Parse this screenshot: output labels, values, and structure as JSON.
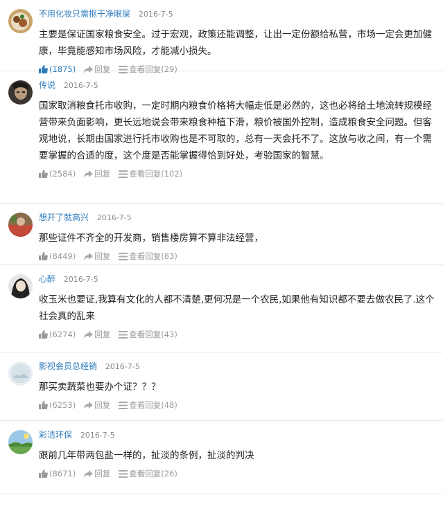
{
  "labels": {
    "reply": "回复",
    "view_replies": "查看回复"
  },
  "comments": [
    {
      "username": "不用化妆只需抠干净眼屎",
      "date": "2016-7-5",
      "text": "主要是保证国家粮食安全。过于宏观，政策还能调整，让出一定份额给私营，市场一定会更加健康，毕竟能感知市场风险，才能减小损失。",
      "likes": "(1875)",
      "reply_count": "(29)",
      "avatar_icon": "avatar-food-icon"
    },
    {
      "username": "传说",
      "date": "2016-7-5",
      "text": "国家取消粮食托市收购，一定时期内粮食价格将大幅走低是必然的，这也必将给土地流转规模经营带来负面影响，更长远地说会带来粮食种植下滑，粮价被国外控制，造成粮食安全问题。但客观地说，长期由国家进行托市收购也是不可取的，总有一天会托不了。这放与收之间，有一个需要掌握的合适的度，这个度是否能掌握得恰到好处，考验国家的智慧。",
      "likes": "(2584)",
      "reply_count": "(102)",
      "avatar_icon": "avatar-warrior-icon"
    },
    {
      "username": "想开了就高兴",
      "date": "2016-7-5",
      "text": "那些证件不齐全的开发商，销售楼房算不算非法经营，",
      "likes": "(8449)",
      "reply_count": "(83)",
      "avatar_icon": "avatar-photo-icon"
    },
    {
      "username": "心醉",
      "date": "2016-7-5",
      "text": "收玉米也要证,我算有文化的人都不清楚,更何况是一个农民,如果他有知识都不要去做农民了.这个社会真的乱来",
      "likes": "(6274)",
      "reply_count": "(43)",
      "avatar_icon": "avatar-anime-icon"
    },
    {
      "username": "影视会员总经销",
      "date": "2016-7-5",
      "text": "那买卖蔬菜也要办个证？？？",
      "likes": "(6253)",
      "reply_count": "(48)",
      "avatar_icon": "avatar-default-icon"
    },
    {
      "username": "彩洁环保",
      "date": "2016-7-5",
      "text": "跟前几年带两包盐一样的，扯淡的条例，扯淡的判决",
      "likes": "(8671)",
      "reply_count": "(26)",
      "avatar_icon": "avatar-landscape-icon"
    }
  ]
}
